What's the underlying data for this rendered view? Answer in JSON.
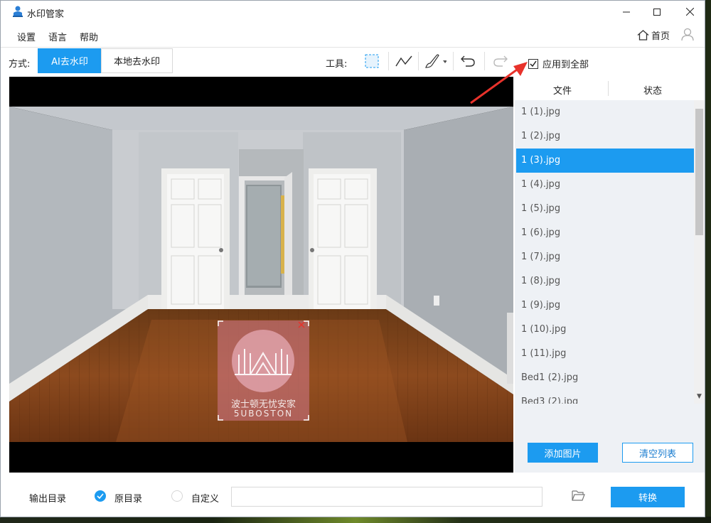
{
  "window": {
    "title": "水印管家"
  },
  "menu": {
    "items": [
      "设置",
      "语言",
      "帮助"
    ],
    "home_label": "首页"
  },
  "toolbar": {
    "mode_label": "方式:",
    "modes": [
      "AI去水印",
      "本地去水印"
    ],
    "active_mode": "AI去水印",
    "tools_label": "工具:",
    "tools": [
      "select-rect-icon",
      "polyline-icon",
      "brush-icon",
      "undo-icon",
      "redo-icon"
    ],
    "apply_all_label": "应用到全部",
    "apply_all_checked": true
  },
  "watermark": {
    "line1": "波士顿无忧安家",
    "line2": "5UBOSTON"
  },
  "file_panel": {
    "col_file": "文件",
    "col_status": "状态",
    "files": [
      "1 (1).jpg",
      "1 (2).jpg",
      "1 (3).jpg",
      "1 (4).jpg",
      "1 (5).jpg",
      "1 (6).jpg",
      "1 (7).jpg",
      "1 (8).jpg",
      "1 (9).jpg",
      "1 (10).jpg",
      "1 (11).jpg",
      "Bed1 (2).jpg",
      "Bed3 (2).jpg"
    ],
    "selected_file": "1 (3).jpg",
    "add_button": "添加图片",
    "clear_button": "清空列表"
  },
  "bottom": {
    "output_label": "输出目录",
    "option_original": "原目录",
    "option_custom": "自定义",
    "selected_option": "原目录",
    "path_value": "",
    "convert_button": "转换"
  },
  "colors": {
    "accent": "#1c9bf0",
    "annotation": "#e8322b"
  }
}
